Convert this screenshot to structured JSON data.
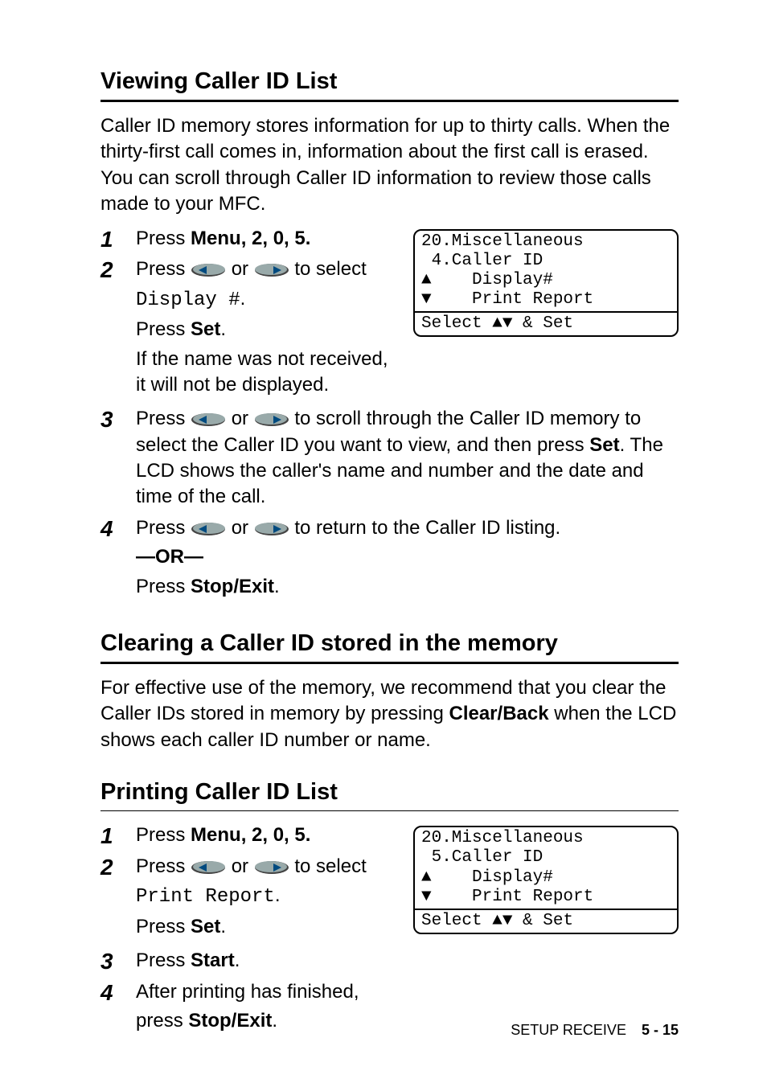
{
  "section1": {
    "title": "Viewing Caller ID List",
    "intro": "Caller ID memory stores information for up to thirty calls. When the thirty-first call comes in, information about the first call is erased. You can scroll through Caller ID information to review those calls made to your MFC.",
    "step1": {
      "press": "Press ",
      "menu": "Menu",
      "keys": ", 2, 0, 5."
    },
    "step2": {
      "pressA": "Press ",
      "or": " or ",
      "toSelect": " to select",
      "displayHash": "Display #",
      "dot": ".",
      "pressB": "Press ",
      "set": "Set",
      "dot2": ".",
      "note": "If the name was not received, it will not be displayed."
    },
    "lcd": {
      "l1": "20.Miscellaneous",
      "l2": " 4.Caller ID",
      "l3": "    Display#",
      "l4": "    Print Report",
      "footerA": "Select ",
      "footerB": " & Set"
    },
    "step3": {
      "pressA": "Press ",
      "or": " or ",
      "mid": " to scroll through the Caller ID memory to select the Caller ID you want to view, and then press ",
      "set": "Set",
      "tail": ". The LCD shows the caller's name and number and the date and time of the call."
    },
    "step4": {
      "pressA": "Press ",
      "or": " or ",
      "tail1": " to return to the Caller ID listing.",
      "orDash": "—OR—",
      "pressB": "Press ",
      "stopExit": "Stop/Exit",
      "dot": "."
    }
  },
  "section2": {
    "title": "Clearing a Caller ID stored in the memory",
    "paraA": "For effective use of the memory, we recommend that you clear the Caller IDs stored in memory by pressing ",
    "clearBack": "Clear/Back",
    "paraB": " when the LCD shows each caller ID number or name."
  },
  "section3": {
    "title": "Printing Caller ID List",
    "step1": {
      "press": "Press ",
      "menu": "Menu",
      "keys": ", 2, 0, 5."
    },
    "step2": {
      "pressA": "Press ",
      "or": " or ",
      "toSelect": " to select",
      "printReport": "Print Report",
      "dot": ".",
      "pressB": "Press ",
      "set": "Set",
      "dot2": "."
    },
    "step3": {
      "press": "Press ",
      "start": "Start",
      "dot": "."
    },
    "step4": {
      "line1": "After printing has finished,",
      "press": "press ",
      "stopExit": "Stop/Exit",
      "dot": "."
    },
    "lcd": {
      "l1": "20.Miscellaneous",
      "l2": " 5.Caller ID",
      "l3": "    Display#",
      "l4": "    Print Report",
      "footerA": "Select ",
      "footerB": " & Set"
    }
  },
  "footer": {
    "label": "SETUP RECEIVE",
    "page": "5 - 15"
  }
}
